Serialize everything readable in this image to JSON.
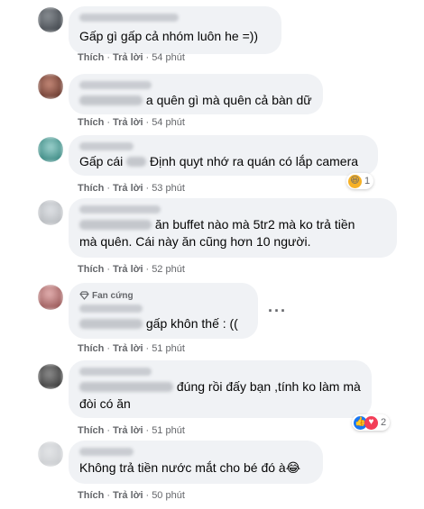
{
  "comments": [
    {
      "text": "Gấp gì gấp cả nhóm luôn he =))",
      "actions": {
        "like": "Thích",
        "reply": "Trả lời",
        "time": "54 phút"
      }
    },
    {
      "text": "a quên gì mà quên cả bàn dữ",
      "actions": {
        "like": "Thích",
        "reply": "Trả lời",
        "time": "54 phút"
      }
    },
    {
      "text_a": "Gấp cái",
      "text_b": "Định quyt nhớ ra quán có lắp camera",
      "actions": {
        "like": "Thích",
        "reply": "Trả lời",
        "time": "53 phút"
      },
      "reactions": {
        "icon": "haha-reaction-icon",
        "count": "1"
      }
    },
    {
      "line1": "ăn buffet nào mà 5tr2 mà ko trả tiền",
      "line2": "mà quên. Cái này ăn cũng hơn 10 người.",
      "actions": {
        "like": "Thích",
        "reply": "Trả lời",
        "time": "52 phút"
      }
    },
    {
      "badge": "Fan cứng",
      "text": "gấp khôn thế : ((",
      "more": "···",
      "actions": {
        "like": "Thích",
        "reply": "Trả lời",
        "time": "51 phút"
      }
    },
    {
      "line1": "đúng rồi đấy bạn ,tính ko làm mà",
      "line2": "đòi có ăn",
      "actions": {
        "like": "Thích",
        "reply": "Trả lời",
        "time": "51 phút"
      },
      "reactions": {
        "icons": [
          "like-reaction-icon",
          "love-reaction-icon"
        ],
        "count": "2"
      }
    },
    {
      "text": "Không trả tiền nước mắt cho bé đó à😂",
      "actions": {
        "like": "Thích",
        "reply": "Trả lời",
        "time": "50 phút"
      }
    }
  ],
  "colors": {
    "bubble": "#f0f2f5",
    "secondary_text": "#65676b",
    "haha": "#f7b125",
    "like": "#1877f2",
    "love": "#f33e58"
  }
}
